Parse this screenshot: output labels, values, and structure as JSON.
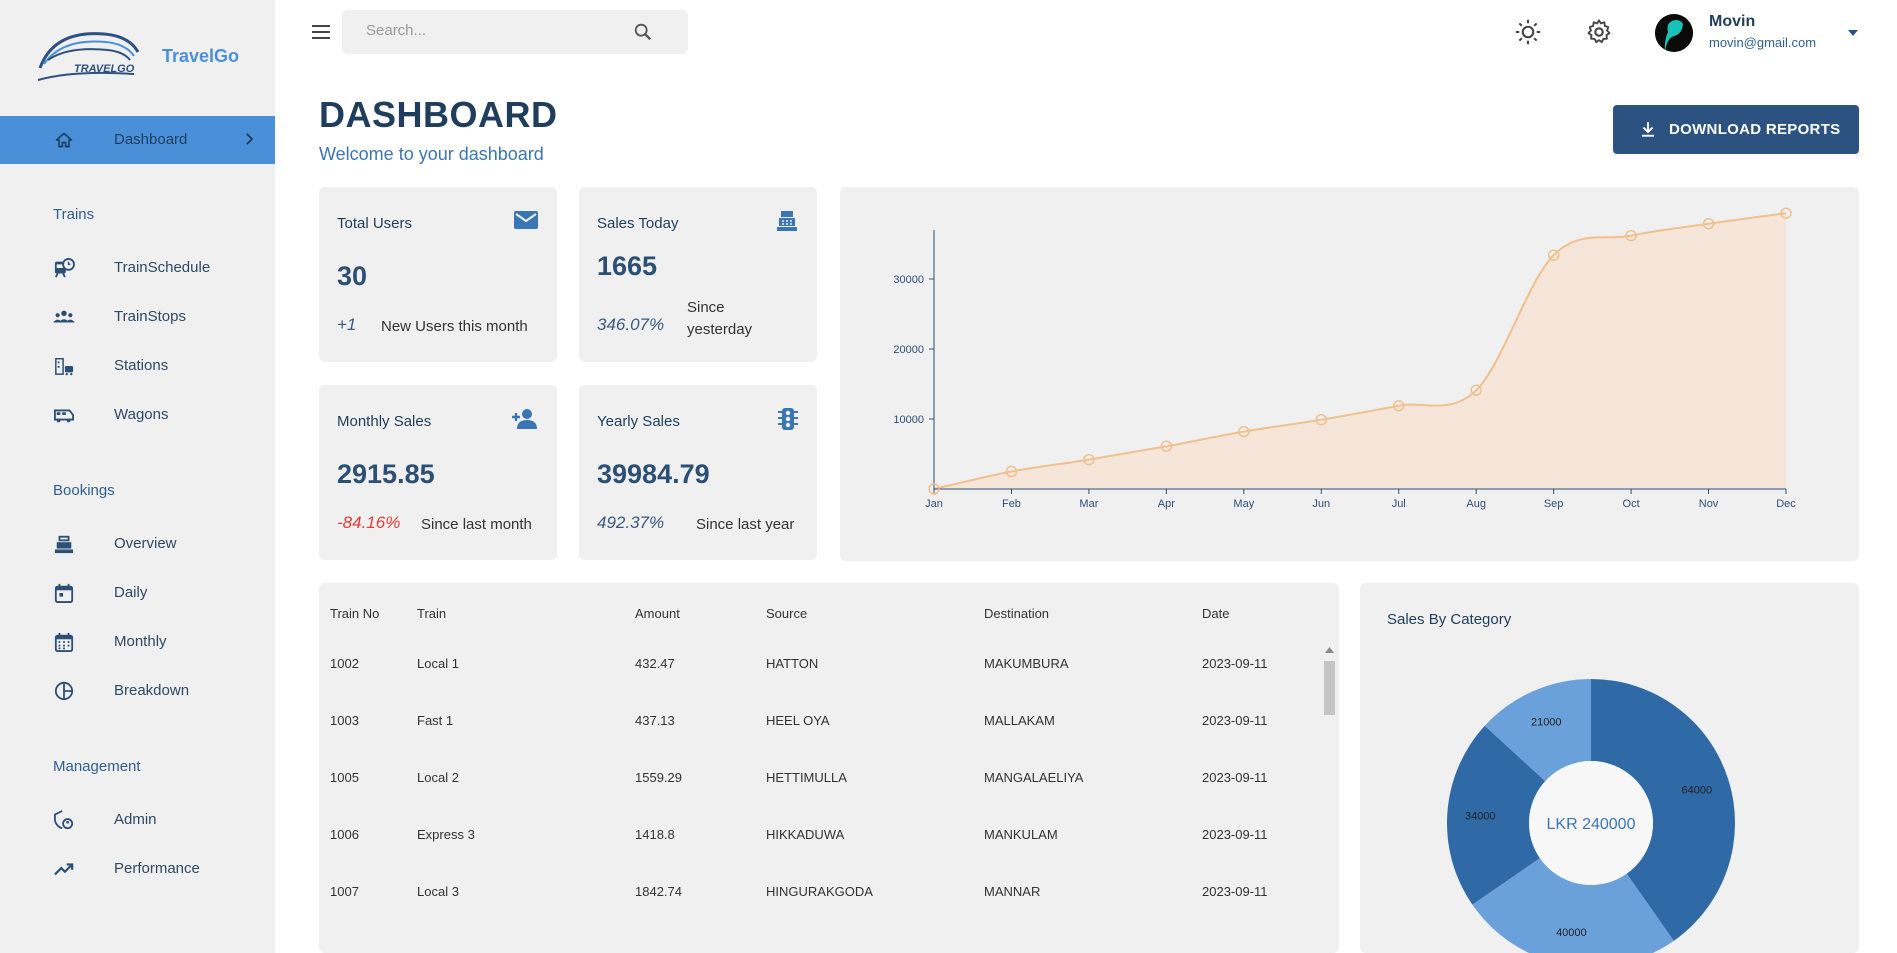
{
  "brand": {
    "name": "TravelGo",
    "logo_text": "TRAVELGO"
  },
  "search": {
    "placeholder": "Search..."
  },
  "user": {
    "name": "Movin",
    "email": "movin@gmail.com"
  },
  "sidebar": {
    "active": {
      "label": "Dashboard",
      "icon": "home-icon"
    },
    "sections": [
      {
        "title": "Trains",
        "items": [
          {
            "label": "TrainSchedule",
            "icon": "train-clock-icon"
          },
          {
            "label": "TrainStops",
            "icon": "groups-icon"
          },
          {
            "label": "Stations",
            "icon": "station-icon"
          },
          {
            "label": "Wagons",
            "icon": "bus-icon"
          }
        ]
      },
      {
        "title": "Bookings",
        "items": [
          {
            "label": "Overview",
            "icon": "register-icon"
          },
          {
            "label": "Daily",
            "icon": "calendar-day-icon"
          },
          {
            "label": "Monthly",
            "icon": "calendar-month-icon"
          },
          {
            "label": "Breakdown",
            "icon": "pie-chart-icon"
          }
        ]
      },
      {
        "title": "Management",
        "items": [
          {
            "label": "Admin",
            "icon": "admin-icon"
          },
          {
            "label": "Performance",
            "icon": "trending-up-icon"
          }
        ]
      }
    ]
  },
  "header": {
    "title": "DASHBOARD",
    "subtitle": "Welcome to your dashboard",
    "download_label": "DOWNLOAD REPORTS"
  },
  "stats": [
    {
      "title": "Total Users",
      "value": "30",
      "delta": "+1",
      "note": "New Users this month",
      "icon": "email-icon",
      "negative": false
    },
    {
      "title": "Sales Today",
      "value": "1665",
      "delta": "346.07%",
      "note": "Since yesterday",
      "icon": "cash-register-icon",
      "negative": false
    },
    {
      "title": "Monthly Sales",
      "value": "2915.85",
      "delta": "-84.16%",
      "note": "Since last month",
      "icon": "person-add-icon",
      "negative": true
    },
    {
      "title": "Yearly Sales",
      "value": "39984.79",
      "delta": "492.37%",
      "note": "Since last year",
      "icon": "traffic-icon",
      "negative": false
    }
  ],
  "chart_data": [
    {
      "type": "area",
      "x": [
        "Jan",
        "Feb",
        "Mar",
        "Apr",
        "May",
        "Jun",
        "Jul",
        "Aug",
        "Sep",
        "Oct",
        "Nov",
        "Dec"
      ],
      "series": [
        {
          "values": [
            0,
            2500,
            4200,
            6100,
            8200,
            9900,
            11900,
            14100,
            33400,
            36200,
            37900,
            39400
          ]
        }
      ],
      "yticks": [
        10000,
        20000,
        30000
      ],
      "ylim": [
        0,
        40000
      ],
      "color": "#f0c08f",
      "grid": false
    },
    {
      "type": "pie",
      "title": "Sales By Category",
      "center_label": "LKR 240000",
      "values": [
        64000,
        40000,
        34000,
        21000
      ],
      "colors": [
        "#2f6aa6",
        "#6aa1da",
        "#2f6aa6",
        "#6aa1da"
      ]
    }
  ],
  "table": {
    "headers": [
      "Train No",
      "Train",
      "Amount",
      "Source",
      "Destination",
      "Date"
    ],
    "rows": [
      [
        "1002",
        "Local 1",
        "432.47",
        "HATTON",
        "MAKUMBURA",
        "2023-09-11"
      ],
      [
        "1003",
        "Fast 1",
        "437.13",
        "HEEL OYA",
        "MALLAKAM",
        "2023-09-11"
      ],
      [
        "1005",
        "Local 2",
        "1559.29",
        "HETTIMULLA",
        "MANGALAELIYA",
        "2023-09-11"
      ],
      [
        "1006",
        "Express 3",
        "1418.8",
        "HIKKADUWA",
        "MANKULAM",
        "2023-09-11"
      ],
      [
        "1007",
        "Local 3",
        "1842.74",
        "HINGURAKGODA",
        "MANNAR",
        "2023-09-11"
      ]
    ]
  }
}
